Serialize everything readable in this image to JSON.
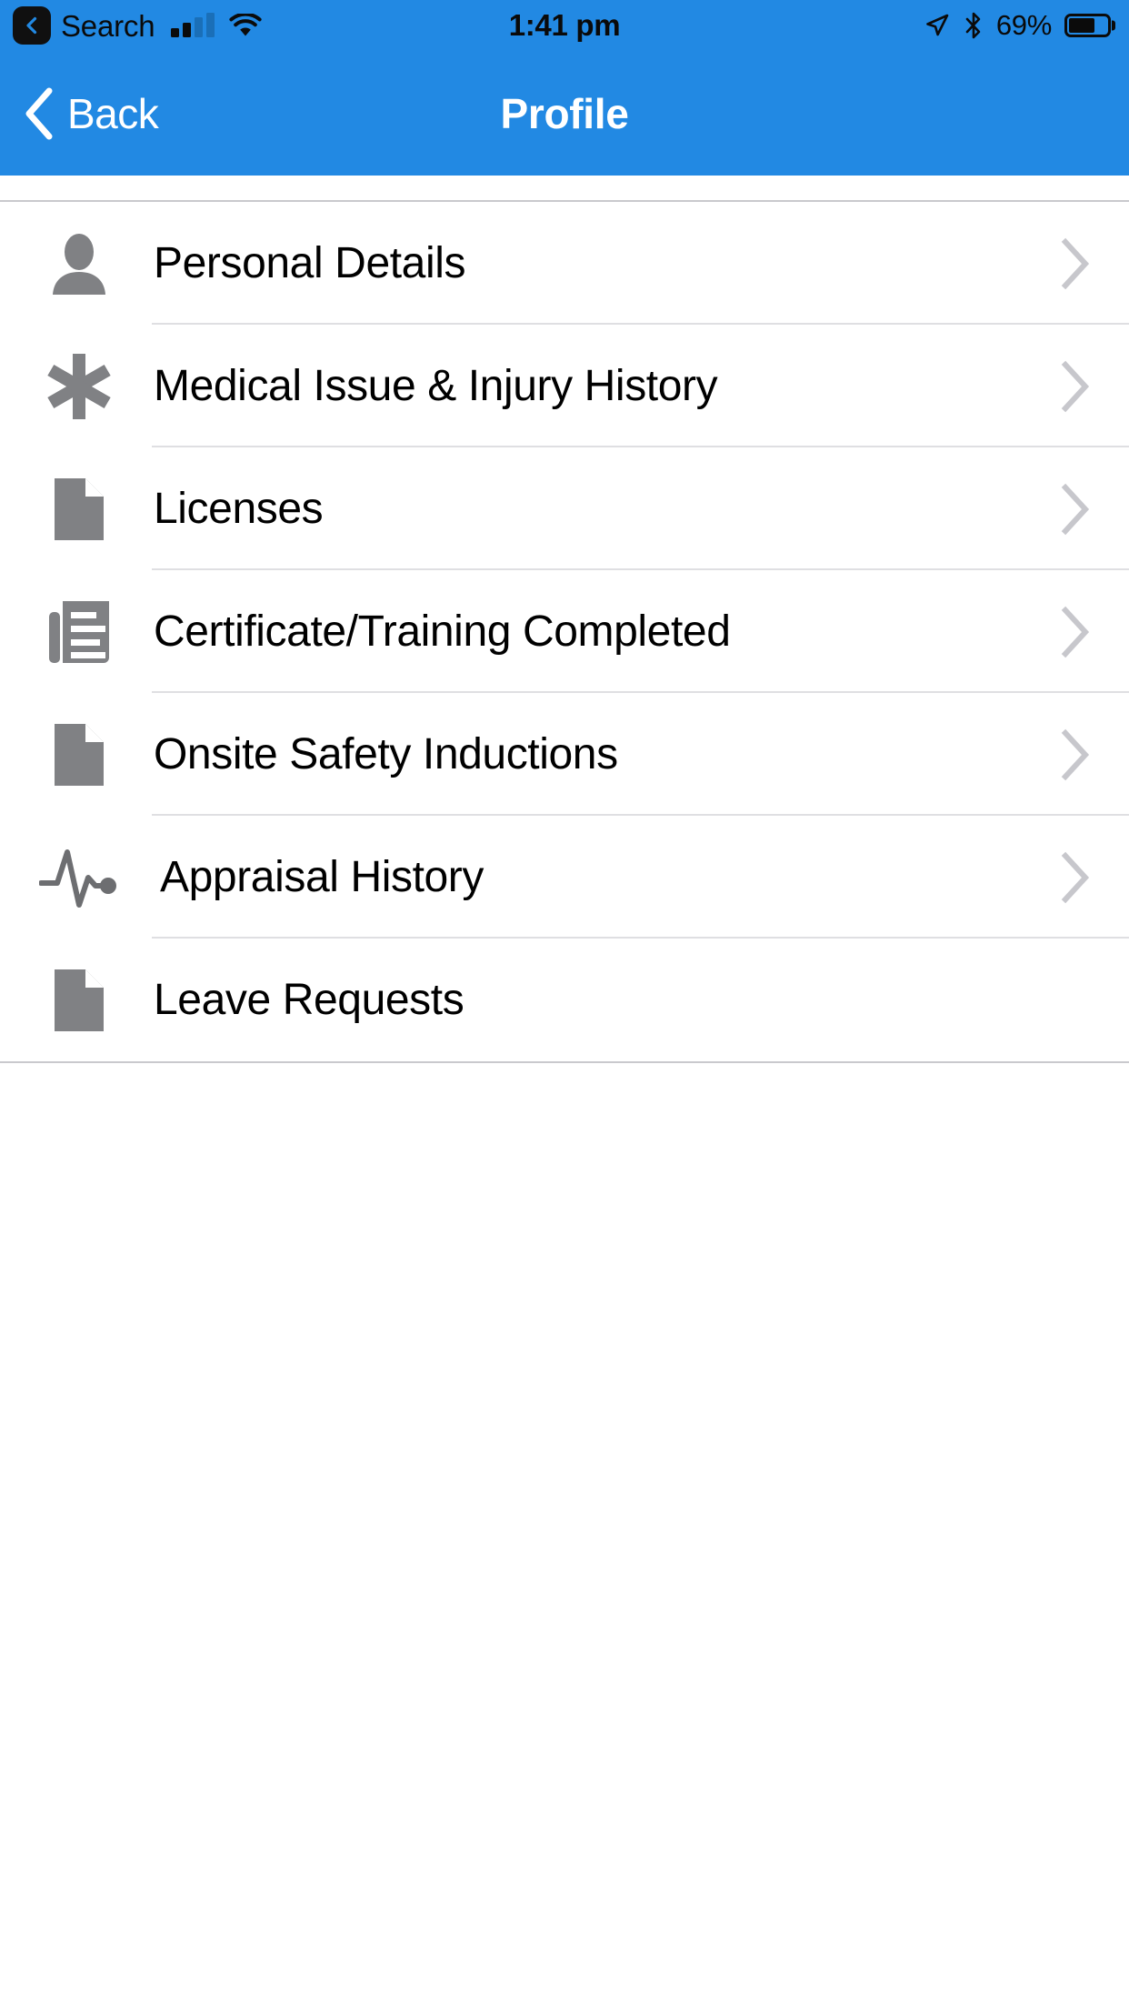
{
  "status_bar": {
    "back_badge_icon": "chevron-left-icon",
    "carrier_label": "Search",
    "signal_icon": "cellular-signal-icon",
    "wifi_icon": "wifi-icon",
    "time": "1:41 pm",
    "location_icon": "location-arrow-icon",
    "bluetooth_icon": "bluetooth-icon",
    "battery_percent": "69%",
    "battery_icon": "battery-icon",
    "battery_level": 69,
    "background_color": "#2289e3",
    "text_color": "#0a0a0a"
  },
  "nav_bar": {
    "back_icon": "chevron-left-icon",
    "back_label": "Back",
    "title": "Profile",
    "background_color": "#2289e3",
    "text_color": "#ffffff"
  },
  "list": {
    "separator_color": "#dfdfe2",
    "border_color": "#c9c9cd",
    "icon_color": "#808184",
    "chevron_color": "#c7c7cc",
    "items": [
      {
        "label": "Personal Details",
        "icon": "person-icon",
        "has_chevron": true,
        "indented": false
      },
      {
        "label": "Medical Issue & Injury History",
        "icon": "asterisk-medical-icon",
        "has_chevron": true,
        "indented": false
      },
      {
        "label": "Licenses",
        "icon": "document-icon",
        "has_chevron": true,
        "indented": false
      },
      {
        "label": "Certificate/Training Completed",
        "icon": "certificate-list-icon",
        "has_chevron": true,
        "indented": false
      },
      {
        "label": "Onsite Safety Inductions",
        "icon": "document-icon",
        "has_chevron": true,
        "indented": false
      },
      {
        "label": "Appraisal History",
        "icon": "pulse-line-icon",
        "has_chevron": true,
        "indented": true
      },
      {
        "label": "Leave Requests",
        "icon": "document-icon",
        "has_chevron": false,
        "indented": false
      }
    ]
  }
}
